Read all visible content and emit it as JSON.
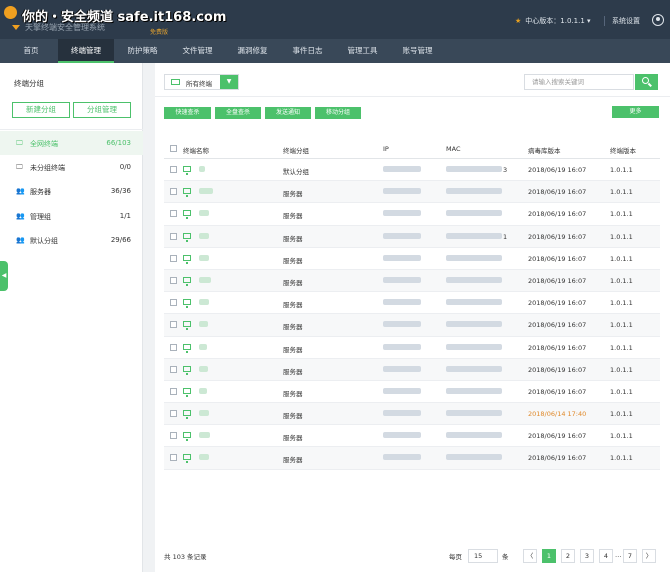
{
  "header": {
    "watermark": "你的・安全频道 safe.it168.com",
    "brand_text": "天擎终端安全管理系统",
    "edition_badge": "免费版",
    "center_version_label": "中心版本：1.0.1.1",
    "system_settings": "系统设置"
  },
  "nav": {
    "tabs": [
      {
        "label": "首页",
        "active": false
      },
      {
        "label": "终端管理",
        "active": true
      },
      {
        "label": "防护策略",
        "active": false
      },
      {
        "label": "文件管理",
        "active": false
      },
      {
        "label": "漏洞修复",
        "active": false
      },
      {
        "label": "事件日志",
        "active": false
      },
      {
        "label": "管理工具",
        "active": false
      },
      {
        "label": "账号管理",
        "active": false
      }
    ]
  },
  "sidebar": {
    "title": "终端分组",
    "new_group_button": "新建分组",
    "manage_group_button": "分组管理",
    "groups": [
      {
        "label": "全网终端",
        "count": "66/103",
        "icon": "monitor-icon",
        "active": true
      },
      {
        "label": "未分组终端",
        "count": "0/0",
        "icon": "monitor-icon",
        "active": false
      },
      {
        "label": "服务器",
        "count": "36/36",
        "icon": "users-icon",
        "active": false
      },
      {
        "label": "管理组",
        "count": "1/1",
        "icon": "users-icon",
        "active": false
      },
      {
        "label": "默认分组",
        "count": "29/66",
        "icon": "users-icon",
        "active": false
      }
    ]
  },
  "toolbar": {
    "filter_label": "所有终端",
    "search_placeholder": "请输入搜索关键词",
    "actions": [
      "快速查杀",
      "全盘查杀",
      "发送通知",
      "移动分组"
    ],
    "more_button": "更多"
  },
  "table": {
    "columns": [
      "终端名称",
      "终端分组",
      "IP",
      "MAC",
      "病毒库版本",
      "终端版本"
    ],
    "rows": [
      {
        "group": "默认分组",
        "mac_suffix": "3",
        "virus_db": "2018/06/19 16:07",
        "client_ver": "1.0.1.1",
        "warn": false
      },
      {
        "group": "服务器",
        "mac_suffix": "",
        "virus_db": "2018/06/19 16:07",
        "client_ver": "1.0.1.1",
        "warn": false
      },
      {
        "group": "服务器",
        "mac_suffix": "",
        "virus_db": "2018/06/19 16:07",
        "client_ver": "1.0.1.1",
        "warn": false
      },
      {
        "group": "服务器",
        "mac_suffix": "1",
        "virus_db": "2018/06/19 16:07",
        "client_ver": "1.0.1.1",
        "warn": false
      },
      {
        "group": "服务器",
        "mac_suffix": "",
        "virus_db": "2018/06/19 16:07",
        "client_ver": "1.0.1.1",
        "warn": false
      },
      {
        "group": "服务器",
        "mac_suffix": "",
        "virus_db": "2018/06/19 16:07",
        "client_ver": "1.0.1.1",
        "warn": false
      },
      {
        "group": "服务器",
        "mac_suffix": "",
        "virus_db": "2018/06/19 16:07",
        "client_ver": "1.0.1.1",
        "warn": false
      },
      {
        "group": "服务器",
        "mac_suffix": "",
        "virus_db": "2018/06/19 16:07",
        "client_ver": "1.0.1.1",
        "warn": false
      },
      {
        "group": "服务器",
        "mac_suffix": "",
        "virus_db": "2018/06/19 16:07",
        "client_ver": "1.0.1.1",
        "warn": false
      },
      {
        "group": "服务器",
        "mac_suffix": "",
        "virus_db": "2018/06/19 16:07",
        "client_ver": "1.0.1.1",
        "warn": false
      },
      {
        "group": "服务器",
        "mac_suffix": "",
        "virus_db": "2018/06/19 16:07",
        "client_ver": "1.0.1.1",
        "warn": false
      },
      {
        "group": "服务器",
        "mac_suffix": "",
        "virus_db": "2018/06/14 17:40",
        "client_ver": "1.0.1.1",
        "warn": true
      },
      {
        "group": "服务器",
        "mac_suffix": "",
        "virus_db": "2018/06/19 16:07",
        "client_ver": "1.0.1.1",
        "warn": false
      },
      {
        "group": "服务器",
        "mac_suffix": "",
        "virus_db": "2018/06/19 16:07",
        "client_ver": "1.0.1.1",
        "warn": false
      }
    ]
  },
  "pagination": {
    "total_text": "共 103 条记录",
    "per_page_label": "每页",
    "per_page_value": "15",
    "per_page_unit": "条",
    "prev": "〈",
    "pages": [
      "1",
      "2",
      "3",
      "4",
      "7"
    ],
    "ellipsis": "…",
    "next": "〉",
    "current": "1"
  },
  "colors": {
    "accent": "#4cc16b",
    "topbar": "#2d3b4b",
    "nav": "#394858",
    "warning_text": "#e0892a"
  }
}
